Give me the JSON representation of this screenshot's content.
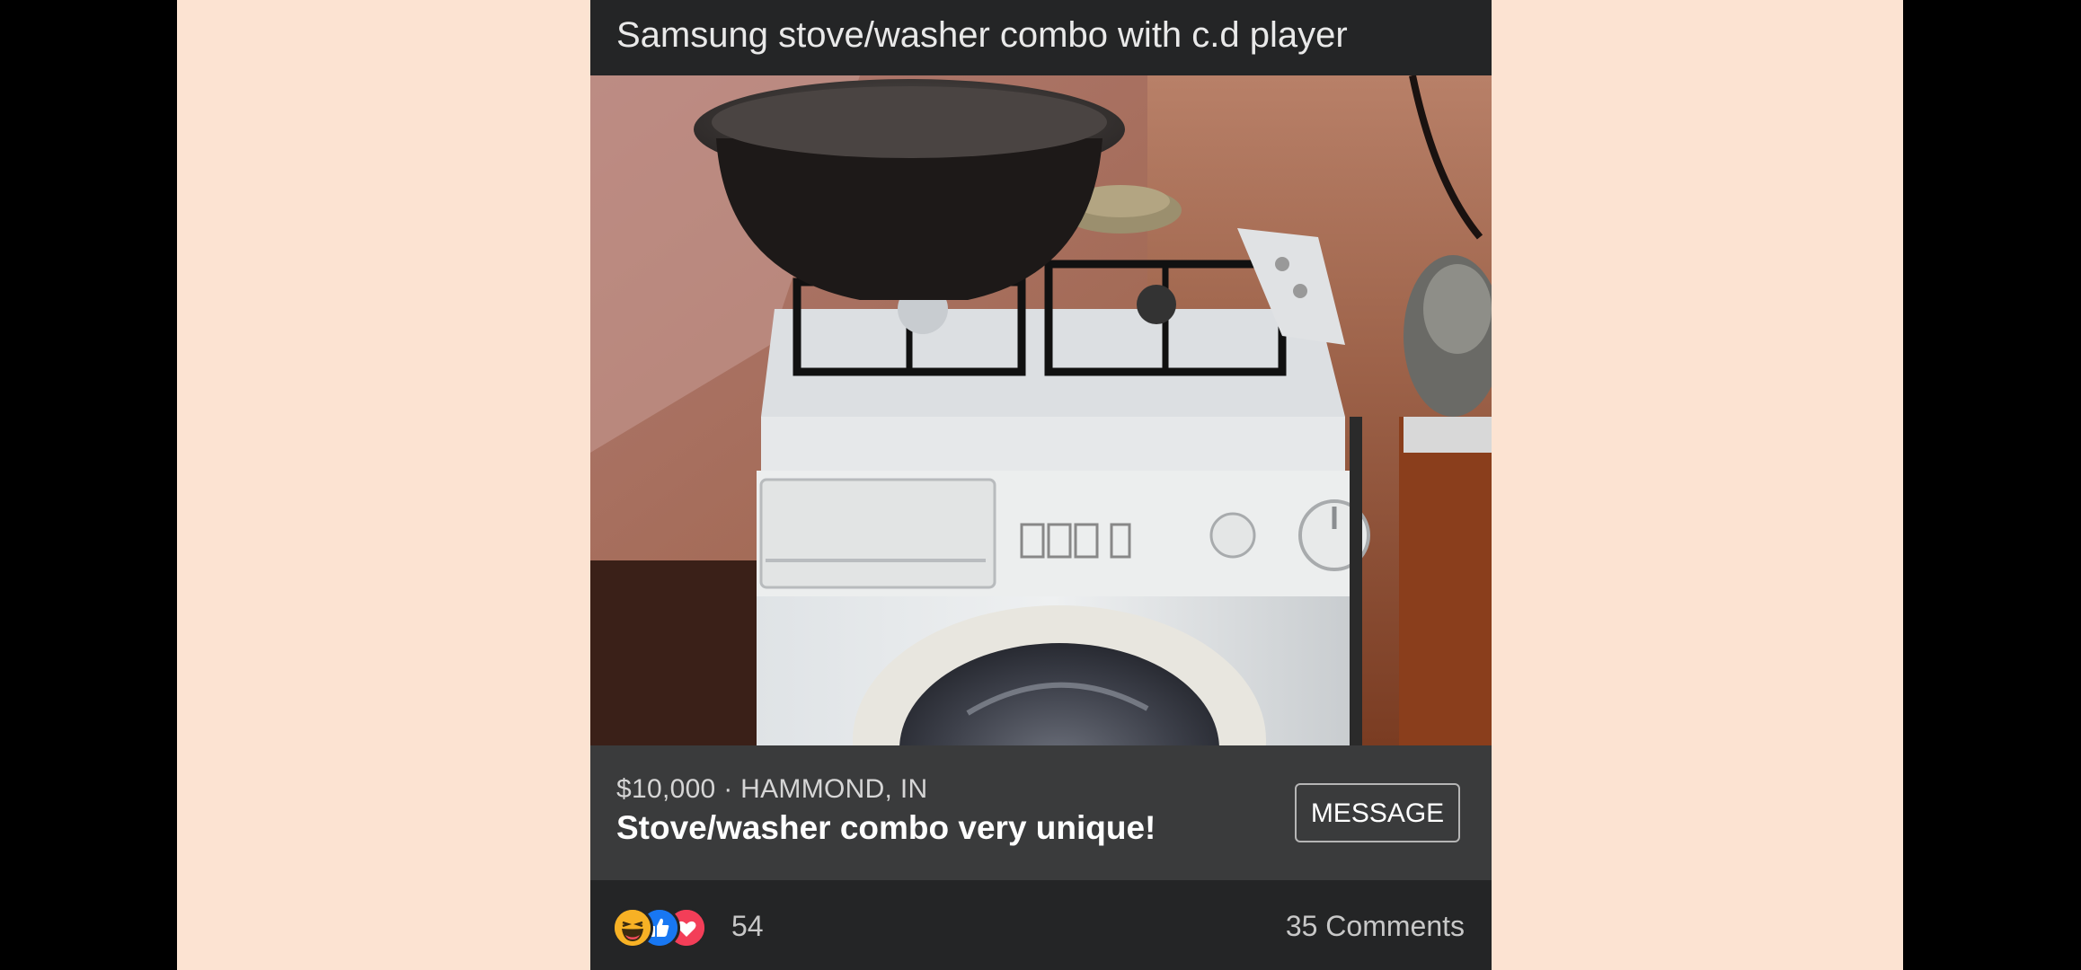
{
  "post": {
    "title": "Samsung stove/washer combo with c.d player"
  },
  "listing": {
    "price": "$10,000",
    "separator": "·",
    "location": "HAMMOND, IN",
    "headline": "Stove/washer combo very unique!",
    "message_button": "MESSAGE"
  },
  "reactions": {
    "icons": [
      "haha-icon",
      "like-icon",
      "love-icon"
    ],
    "count": "54",
    "comments": "35 Comments"
  },
  "colors": {
    "page_background": "#fce3d2",
    "card_background": "#242526",
    "listing_bar": "#3a3b3c",
    "like_blue": "#1877f2",
    "love_red": "#f33e58",
    "haha_yellow": "#f7b125"
  }
}
